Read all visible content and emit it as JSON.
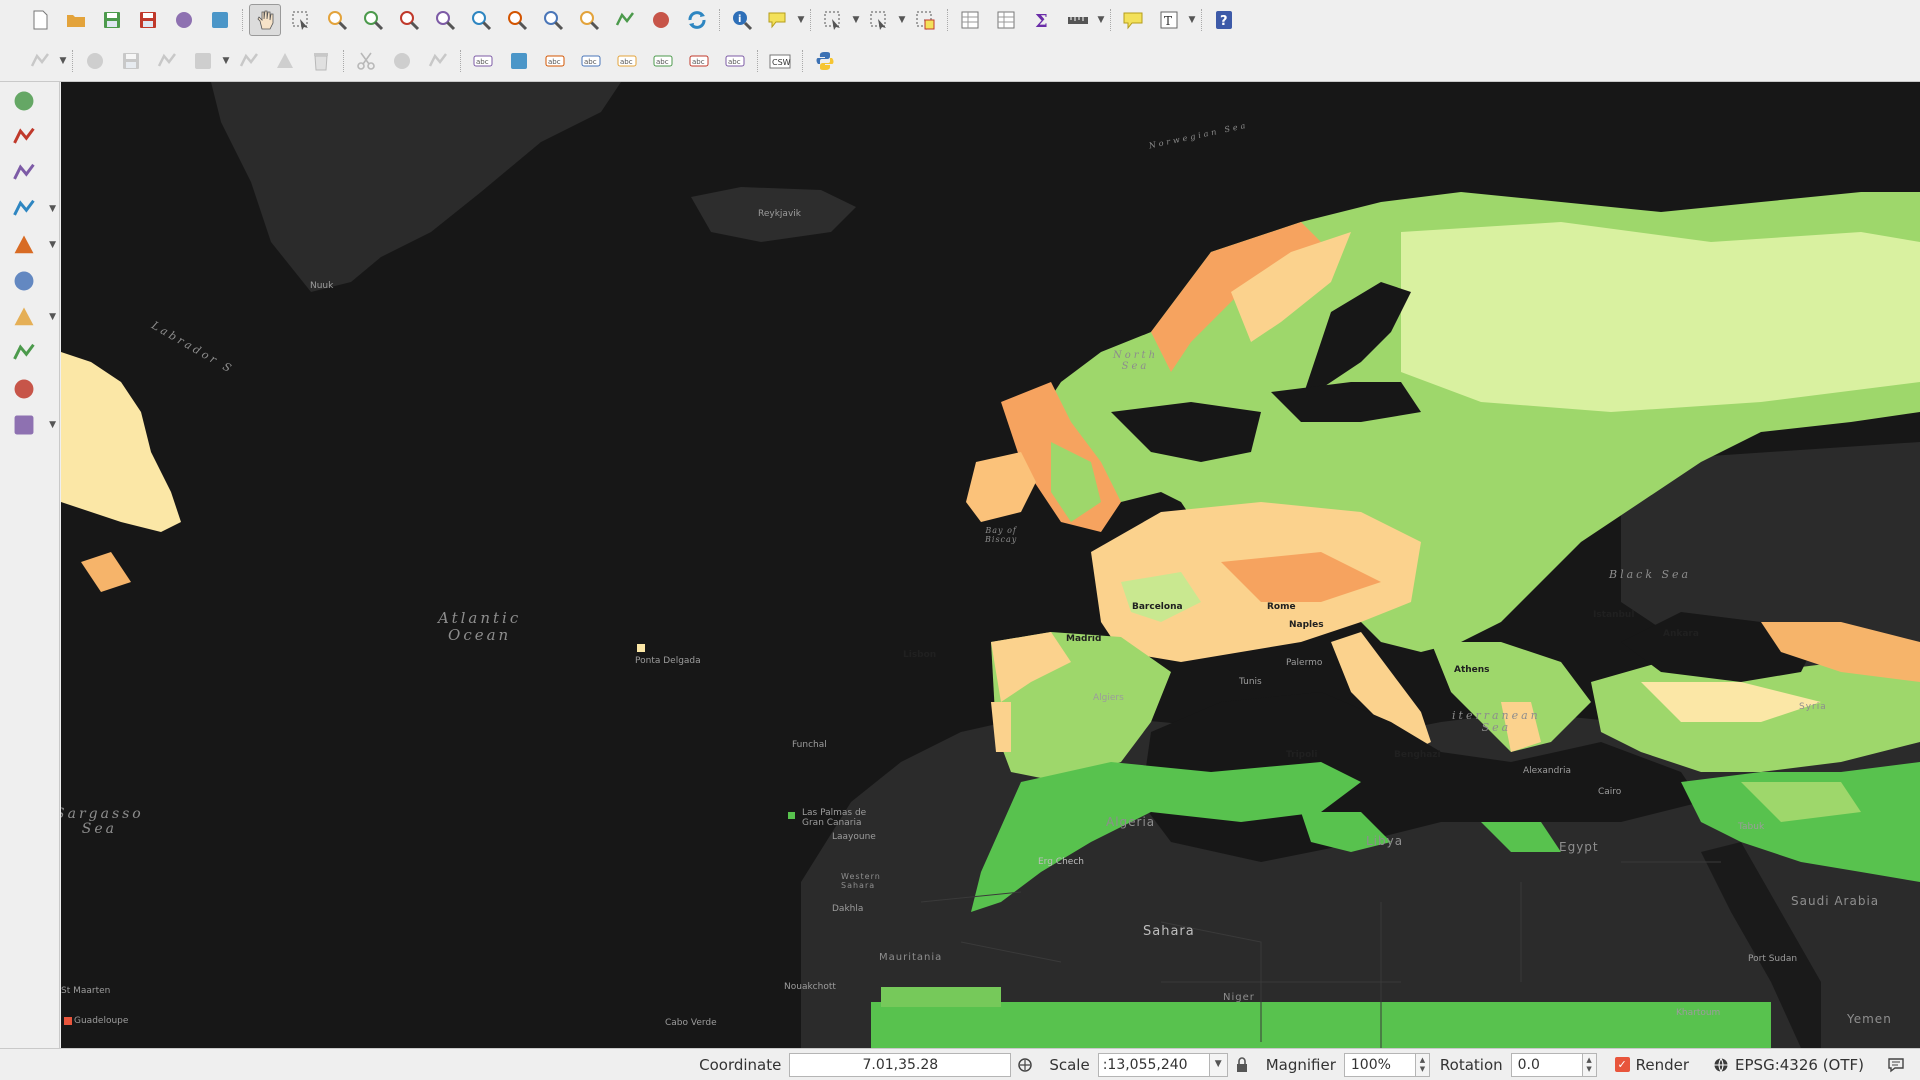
{
  "toolbar_top": [
    {
      "name": "new-project-icon"
    },
    {
      "name": "open-project-icon"
    },
    {
      "name": "save-project-icon"
    },
    {
      "name": "save-as-icon"
    },
    {
      "name": "new-print-layout-icon"
    },
    {
      "name": "layout-manager-icon"
    },
    {
      "name": "pan-map-icon",
      "active": true
    },
    {
      "name": "pan-to-selection-icon"
    },
    {
      "name": "zoom-in-icon"
    },
    {
      "name": "zoom-out-icon"
    },
    {
      "name": "zoom-native-icon"
    },
    {
      "name": "zoom-full-icon"
    },
    {
      "name": "zoom-to-selection-icon"
    },
    {
      "name": "zoom-to-layer-icon"
    },
    {
      "name": "zoom-last-icon"
    },
    {
      "name": "zoom-next-icon"
    },
    {
      "name": "new-bookmark-icon"
    },
    {
      "name": "show-bookmarks-icon"
    },
    {
      "name": "refresh-icon"
    },
    {
      "name": "identify-features-icon"
    },
    {
      "name": "map-tips-icon"
    },
    {
      "name": "select-features-icon"
    },
    {
      "name": "select-by-value-icon"
    },
    {
      "name": "deselect-all-icon"
    },
    {
      "name": "attribute-table-icon"
    },
    {
      "name": "field-calculator-icon"
    },
    {
      "name": "statistical-summary-icon"
    },
    {
      "name": "measure-line-icon"
    },
    {
      "name": "text-annotation-icon"
    },
    {
      "name": "text-annotation-tool-icon"
    },
    {
      "name": "help-icon"
    }
  ],
  "toolbar_second": [
    {
      "name": "current-edits-icon"
    },
    {
      "name": "toggle-editing-icon"
    },
    {
      "name": "save-layer-edits-icon"
    },
    {
      "name": "digitize-icon"
    },
    {
      "name": "add-feature-icon"
    },
    {
      "name": "vertex-tool-icon"
    },
    {
      "name": "modify-attributes-icon"
    },
    {
      "name": "delete-selected-icon"
    },
    {
      "name": "cut-features-icon"
    },
    {
      "name": "copy-features-icon"
    },
    {
      "name": "paste-features-icon"
    },
    {
      "name": "label-toolbar-icon"
    },
    {
      "name": "diagram-options-icon"
    },
    {
      "name": "highlight-pinned-labels-icon"
    },
    {
      "name": "pin-labels-icon"
    },
    {
      "name": "show-hide-labels-icon"
    },
    {
      "name": "move-label-icon"
    },
    {
      "name": "rotate-label-icon"
    },
    {
      "name": "change-label-icon"
    },
    {
      "name": "csw-icon",
      "label": "CSW"
    },
    {
      "name": "python-console-icon"
    }
  ],
  "left_toolbar": [
    {
      "name": "add-vector-layer-icon",
      "dropdown": false
    },
    {
      "name": "add-raster-layer-icon",
      "dropdown": false
    },
    {
      "name": "add-delimited-text-icon",
      "dropdown": false
    },
    {
      "name": "add-postgis-layer-icon",
      "dropdown": true
    },
    {
      "name": "add-spatialite-layer-icon",
      "dropdown": true
    },
    {
      "name": "add-wms-layer-icon",
      "dropdown": false
    },
    {
      "name": "add-wfs-layer-icon",
      "dropdown": true
    },
    {
      "name": "add-wcs-layer-icon",
      "dropdown": false
    },
    {
      "name": "add-virtual-layer-icon",
      "dropdown": false
    },
    {
      "name": "new-shapefile-layer-icon",
      "dropdown": true
    }
  ],
  "map": {
    "ocean_labels": [
      {
        "text": "Atlantic\nOcean"
      },
      {
        "text": "Sargasso\nSea"
      },
      {
        "text": "Labrador S"
      },
      {
        "text": "North\nSea"
      },
      {
        "text": "Black Sea"
      },
      {
        "text": "iterranean\nSea"
      },
      {
        "text": "Bay of\nBiscay"
      },
      {
        "text": "Norwegian Sea"
      }
    ],
    "land_labels": [
      {
        "text": "Sahara"
      },
      {
        "text": "Algeria"
      },
      {
        "text": "Libya"
      },
      {
        "text": "Egypt"
      },
      {
        "text": "Mauritania"
      },
      {
        "text": "Western\nSahara"
      },
      {
        "text": "Saudi Arabia"
      },
      {
        "text": "Niger"
      },
      {
        "text": "Erg Chech"
      },
      {
        "text": "Yemen"
      },
      {
        "text": "Syria"
      }
    ],
    "cities": [
      {
        "text": "Ponta Delgada"
      },
      {
        "text": "Funchal"
      },
      {
        "text": "Las Palmas de\nGran Canaria"
      },
      {
        "text": "Laayoune"
      },
      {
        "text": "Dakhla"
      },
      {
        "text": "Nouakchott"
      },
      {
        "text": "Cabo Verde"
      },
      {
        "text": "Lisbon"
      },
      {
        "text": "Madrid"
      },
      {
        "text": "Barcelona"
      },
      {
        "text": "Rome"
      },
      {
        "text": "Naples"
      },
      {
        "text": "Palermo"
      },
      {
        "text": "Tunis"
      },
      {
        "text": "Algiers"
      },
      {
        "text": "Tripoli"
      },
      {
        "text": "Benghazi"
      },
      {
        "text": "Cairo"
      },
      {
        "text": "Alexandria"
      },
      {
        "text": "Athens"
      },
      {
        "text": "Istanbul"
      },
      {
        "text": "Ankara"
      },
      {
        "text": "Tabuk"
      },
      {
        "text": "Port Sudan"
      },
      {
        "text": "Khartoum"
      },
      {
        "text": "Nuuk"
      },
      {
        "text": "Reykjavik"
      },
      {
        "text": "St Maarten"
      },
      {
        "text": "Guadeloupe"
      }
    ]
  },
  "statusbar": {
    "coordinate_label": "Coordinate",
    "coordinate_value": "7.01,35.28",
    "scale_label": "Scale",
    "scale_value": ":13,055,240",
    "magnifier_label": "Magnifier",
    "magnifier_value": "100%",
    "rotation_label": "Rotation",
    "rotation_value": "0.0",
    "render_label": "Render",
    "crs_label": "EPSG:4326 (OTF)"
  },
  "colors": {
    "canvas_bg": "#171717",
    "land_dark": "#2b2b2b",
    "raster_high": "#f6a35f",
    "raster_mid": "#fbe7a6",
    "raster_low": "#9ed76b",
    "raster_green": "#58c24e",
    "accent": "#e8553c"
  }
}
